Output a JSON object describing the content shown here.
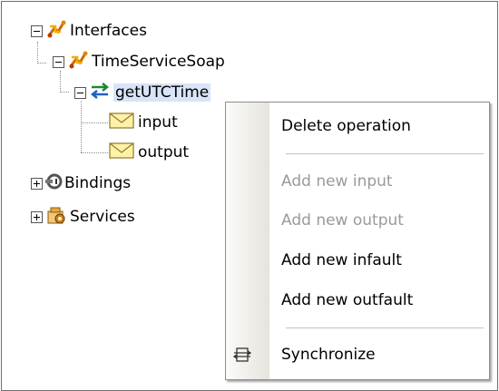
{
  "tree": {
    "interfaces_label": "Interfaces",
    "port_label": "TimeServiceSoap",
    "operation_label": "getUTCTime",
    "input_label": "input",
    "output_label": "output",
    "bindings_label": "Bindings",
    "services_label": "Services"
  },
  "context_menu": {
    "delete_operation": "Delete operation",
    "add_new_input": "Add new input",
    "add_new_output": "Add new output",
    "add_new_infault": "Add new infault",
    "add_new_outfault": "Add new outfault",
    "synchronize": "Synchronize"
  },
  "colors": {
    "selection": "#d8e4f8",
    "disabled_text": "#9a9a9a",
    "gutter": "#e6e4dc"
  },
  "icons": {
    "interfaces": "interfaces-icon",
    "port": "port-type-icon",
    "operation": "operation-arrows-icon",
    "message": "envelope-icon",
    "bindings": "binding-icon",
    "services": "service-icon",
    "synchronize": "synchronize-icon"
  }
}
